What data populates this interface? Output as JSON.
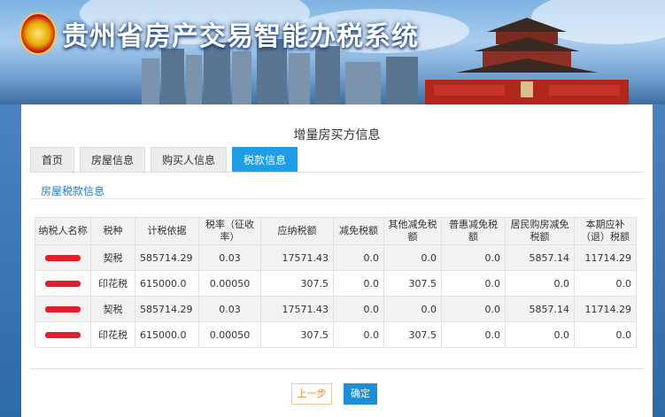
{
  "header": {
    "title": "贵州省房产交易智能办税系统"
  },
  "form": {
    "title": "增量房买方信息"
  },
  "tabs": [
    {
      "label": "首页"
    },
    {
      "label": "房屋信息"
    },
    {
      "label": "购买人信息"
    },
    {
      "label": "税款信息"
    }
  ],
  "active_tab": "税款信息",
  "section": {
    "title": "房屋税款信息"
  },
  "table": {
    "headers": [
      "纳税人名称",
      "税种",
      "计税依据",
      "税率（征收率）",
      "应纳税额",
      "减免税额",
      "其他减免税额",
      "普惠减免税额",
      "居民购房减免税额",
      "本期应补（退）税额"
    ],
    "rows": [
      {
        "tax_type": "契税",
        "basis": "585714.29",
        "rate": "0.03",
        "payable": "17571.43",
        "relief": "0.0",
        "other_relief": "0.0",
        "inclusive_relief": "0.0",
        "resident_relief": "5857.14",
        "due": "11714.29"
      },
      {
        "tax_type": "印花税",
        "basis": "615000.0",
        "rate": "0.00050",
        "payable": "307.5",
        "relief": "0.0",
        "other_relief": "307.5",
        "inclusive_relief": "0.0",
        "resident_relief": "0.0",
        "due": "0.0"
      },
      {
        "tax_type": "契税",
        "basis": "585714.29",
        "rate": "0.03",
        "payable": "17571.43",
        "relief": "0.0",
        "other_relief": "0.0",
        "inclusive_relief": "0.0",
        "resident_relief": "5857.14",
        "due": "11714.29"
      },
      {
        "tax_type": "印花税",
        "basis": "615000.0",
        "rate": "0.00050",
        "payable": "307.5",
        "relief": "0.0",
        "other_relief": "307.5",
        "inclusive_relief": "0.0",
        "resident_relief": "0.0",
        "due": "0.0"
      }
    ]
  },
  "buttons": {
    "prev": "上一步",
    "confirm": "确定"
  },
  "colors": {
    "accent": "#1e9ee6",
    "redaction": "#e0202a",
    "prev_button": "#e2913a"
  }
}
